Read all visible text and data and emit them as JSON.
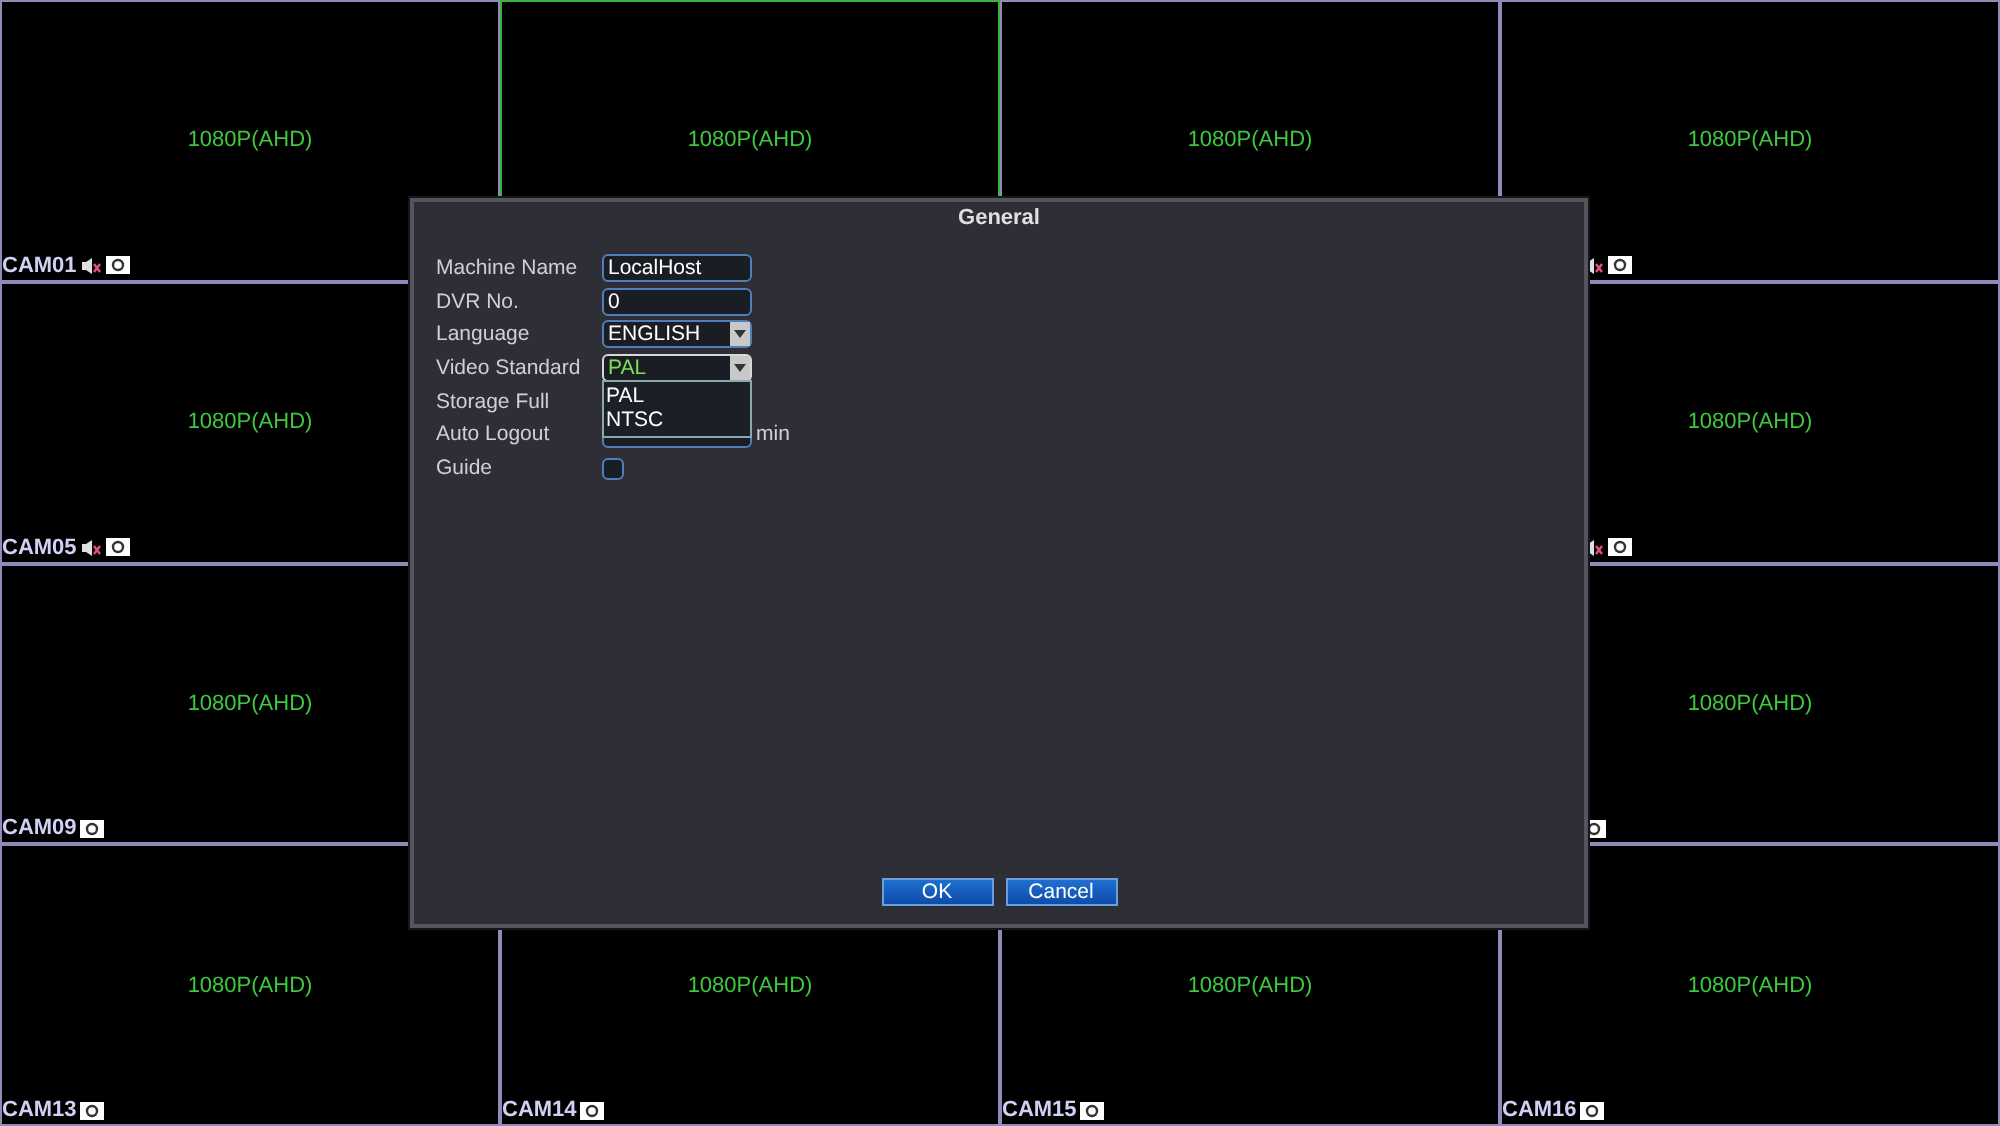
{
  "cells": [
    {
      "resolution": "1080P(AHD)",
      "label": "CAM01",
      "audio": true,
      "selected": false
    },
    {
      "resolution": "1080P(AHD)",
      "selected": true
    },
    {
      "resolution": "1080P(AHD)",
      "selected": false
    },
    {
      "resolution": "1080P(AHD)",
      "audio": true,
      "selected": false
    },
    {
      "resolution": "1080P(AHD)",
      "label": "CAM05",
      "audio": true,
      "selected": false
    },
    {},
    {},
    {
      "resolution": "1080P(AHD)",
      "audio": true,
      "selected": false
    },
    {
      "resolution": "1080P(AHD)",
      "label": "CAM09",
      "audio": false,
      "selected": false
    },
    {},
    {},
    {
      "resolution": "1080P(AHD)",
      "audio": false,
      "selected": false
    },
    {
      "resolution": "1080P(AHD)",
      "label": "CAM13",
      "audio": false,
      "selected": false
    },
    {
      "resolution": "1080P(AHD)",
      "label": "CAM14",
      "audio": false,
      "selected": false
    },
    {
      "resolution": "1080P(AHD)",
      "label": "CAM15",
      "audio": false,
      "selected": false
    },
    {
      "resolution": "1080P(AHD)",
      "label": "CAM16",
      "audio": false,
      "selected": false
    }
  ],
  "dialog": {
    "title": "General",
    "rows": [
      {
        "kind": "text",
        "label": "Machine Name",
        "value": "LocalHost"
      },
      {
        "kind": "text",
        "label": "DVR No.",
        "value": "0"
      },
      {
        "kind": "select",
        "label": "Language",
        "value": "ENGLISH",
        "open": false
      },
      {
        "kind": "select",
        "label": "Video Standard",
        "value": "PAL",
        "open": true,
        "options": [
          {
            "label": "PAL"
          },
          {
            "label": "NTSC"
          }
        ]
      },
      {
        "kind": "hidden",
        "label": "Storage Full"
      },
      {
        "kind": "text",
        "label": "Auto Logout",
        "suffix": "min"
      },
      {
        "kind": "checkbox",
        "label": "Guide",
        "checked": false
      }
    ],
    "buttons": [
      "OK",
      "Cancel"
    ]
  }
}
